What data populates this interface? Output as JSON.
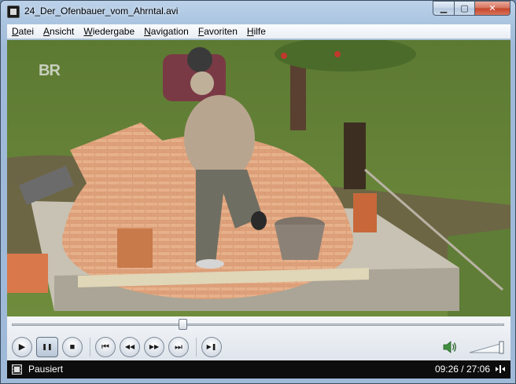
{
  "window": {
    "title": "24_Der_Ofenbauer_vom_Ahrntal.avi"
  },
  "menu": {
    "items": [
      {
        "label": "Datei"
      },
      {
        "label": "Ansicht"
      },
      {
        "label": "Wiedergabe"
      },
      {
        "label": "Navigation"
      },
      {
        "label": "Favoriten"
      },
      {
        "label": "Hilfe"
      }
    ]
  },
  "video": {
    "channel_logo": "BR"
  },
  "seek": {
    "position_fraction": 0.346
  },
  "playback_buttons": [
    {
      "name": "play-button",
      "icon": "play-icon",
      "glyph": "▶"
    },
    {
      "name": "pause-button",
      "icon": "pause-icon",
      "glyph": "❚❚",
      "active": true
    },
    {
      "name": "stop-button",
      "icon": "stop-icon",
      "glyph": "■"
    },
    {
      "name": "previous-button",
      "icon": "skip-previous-icon",
      "glyph": "⏮"
    },
    {
      "name": "rewind-button",
      "icon": "rewind-icon",
      "glyph": "◀◀"
    },
    {
      "name": "fast-forward-button",
      "icon": "fast-forward-icon",
      "glyph": "▶▶"
    },
    {
      "name": "next-button",
      "icon": "skip-next-icon",
      "glyph": "⏭"
    },
    {
      "name": "frame-step-button",
      "icon": "frame-step-icon",
      "glyph": "▶❚"
    }
  ],
  "volume": {
    "icon": "speaker-icon",
    "level_fraction": 0.95
  },
  "status": {
    "state": "Pausiert",
    "time": "09:26 / 27:06",
    "icon": "film-icon",
    "fullscreen_icon": "fullscreen-icon"
  },
  "colors": {
    "titlebar": "#a9c3df",
    "close_button": "#c4432a",
    "statusbar": "#0d0d0d",
    "volume_green": "#4caf50"
  }
}
